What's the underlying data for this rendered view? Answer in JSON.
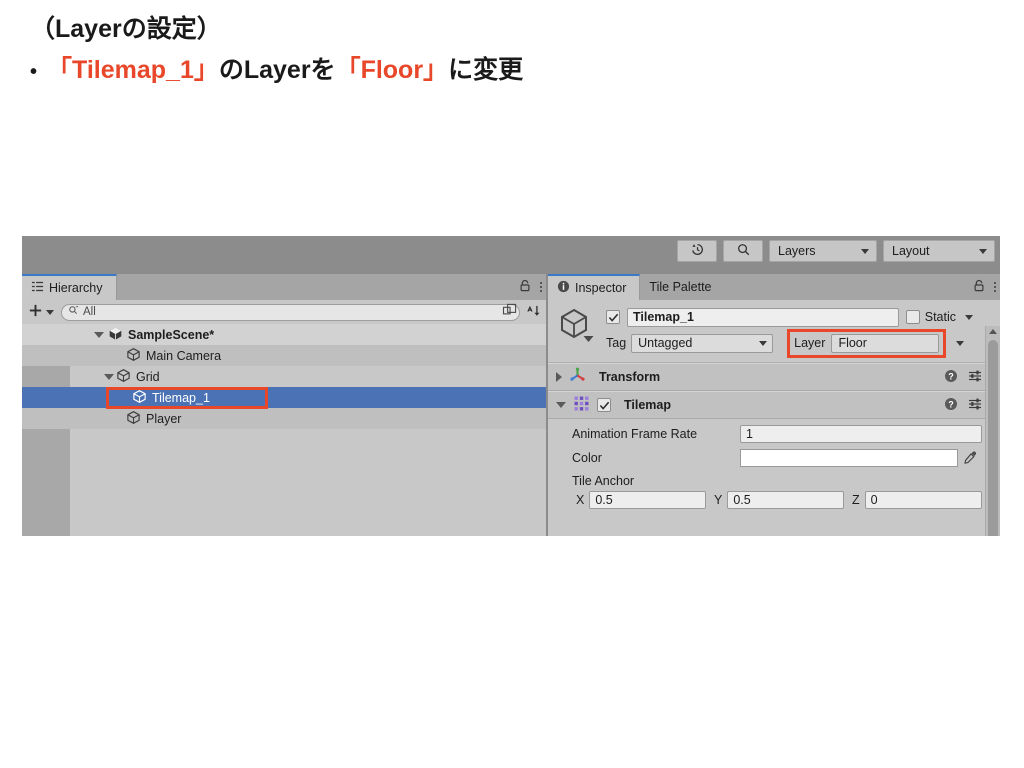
{
  "slide": {
    "title": "（Layerの設定）",
    "bullet_marker": "•",
    "bullet_part1": "「Tilemap_1」",
    "bullet_part2": "のLayerを",
    "bullet_part3": "「Floor」",
    "bullet_part4": "に変更",
    "accent_color": "#e8472a"
  },
  "toolbar": {
    "history_icon": "history-icon",
    "search_icon": "search-icon",
    "layers_label": "Layers",
    "layout_label": "Layout"
  },
  "hierarchy": {
    "tab_label": "Hierarchy",
    "tab_icon": "list-icon",
    "lock_icon": "lock-icon",
    "menu_icon": "kebab-menu-icon",
    "add_label": "+",
    "search_placeholder": "All",
    "search_value": "All",
    "expand_icon": "open-in-window-icon",
    "sort_icon": "sort-alphabetical-icon",
    "tree": [
      {
        "label": "SampleScene*",
        "depth": 0,
        "icon": "unity-scene-icon",
        "expanded": true,
        "bold": true,
        "selected": false
      },
      {
        "label": "Main Camera",
        "depth": 1,
        "icon": "gameobject-cube-icon",
        "expanded": null,
        "bold": false,
        "selected": false
      },
      {
        "label": "Grid",
        "depth": 1,
        "icon": "gameobject-cube-icon",
        "expanded": true,
        "bold": false,
        "selected": false
      },
      {
        "label": "Tilemap_1",
        "depth": 2,
        "icon": "gameobject-cube-icon",
        "expanded": null,
        "bold": false,
        "selected": true,
        "annotated": true
      },
      {
        "label": "Player",
        "depth": 1,
        "icon": "gameobject-cube-icon",
        "expanded": null,
        "bold": false,
        "selected": false
      }
    ]
  },
  "inspector": {
    "tabs": [
      {
        "label": "Inspector",
        "icon": "info-icon",
        "active": true
      },
      {
        "label": "Tile Palette",
        "icon": "",
        "active": false
      }
    ],
    "lock_icon": "lock-icon",
    "menu_icon": "kebab-menu-icon",
    "object": {
      "icon": "gameobject-cube-icon",
      "enabled": true,
      "name": "Tilemap_1",
      "static_label": "Static",
      "static_checked": false,
      "tag_label": "Tag",
      "tag_value": "Untagged",
      "layer_label": "Layer",
      "layer_value": "Floor",
      "layer_annotated": true
    },
    "components": [
      {
        "name": "Transform",
        "icon": "transform-gizmo-icon",
        "expanded": false,
        "has_checkbox": false,
        "help_icon": "help-icon",
        "preset_icon": "preset-icon",
        "menu_icon": "kebab-menu-icon"
      },
      {
        "name": "Tilemap",
        "icon": "tilemap-grid-icon",
        "expanded": true,
        "has_checkbox": true,
        "checked": true,
        "help_icon": "help-icon",
        "preset_icon": "preset-icon",
        "menu_icon": "kebab-menu-icon"
      }
    ],
    "tilemap_properties": {
      "frame_rate_label": "Animation Frame Rate",
      "frame_rate_value": "1",
      "color_label": "Color",
      "color_value": "#ffffff",
      "eyedropper_icon": "eyedropper-icon",
      "tile_anchor_label": "Tile Anchor",
      "anchor_x_label": "X",
      "anchor_x_value": "0.5",
      "anchor_y_label": "Y",
      "anchor_y_value": "0.5",
      "anchor_z_label": "Z",
      "anchor_z_value": "0"
    }
  }
}
